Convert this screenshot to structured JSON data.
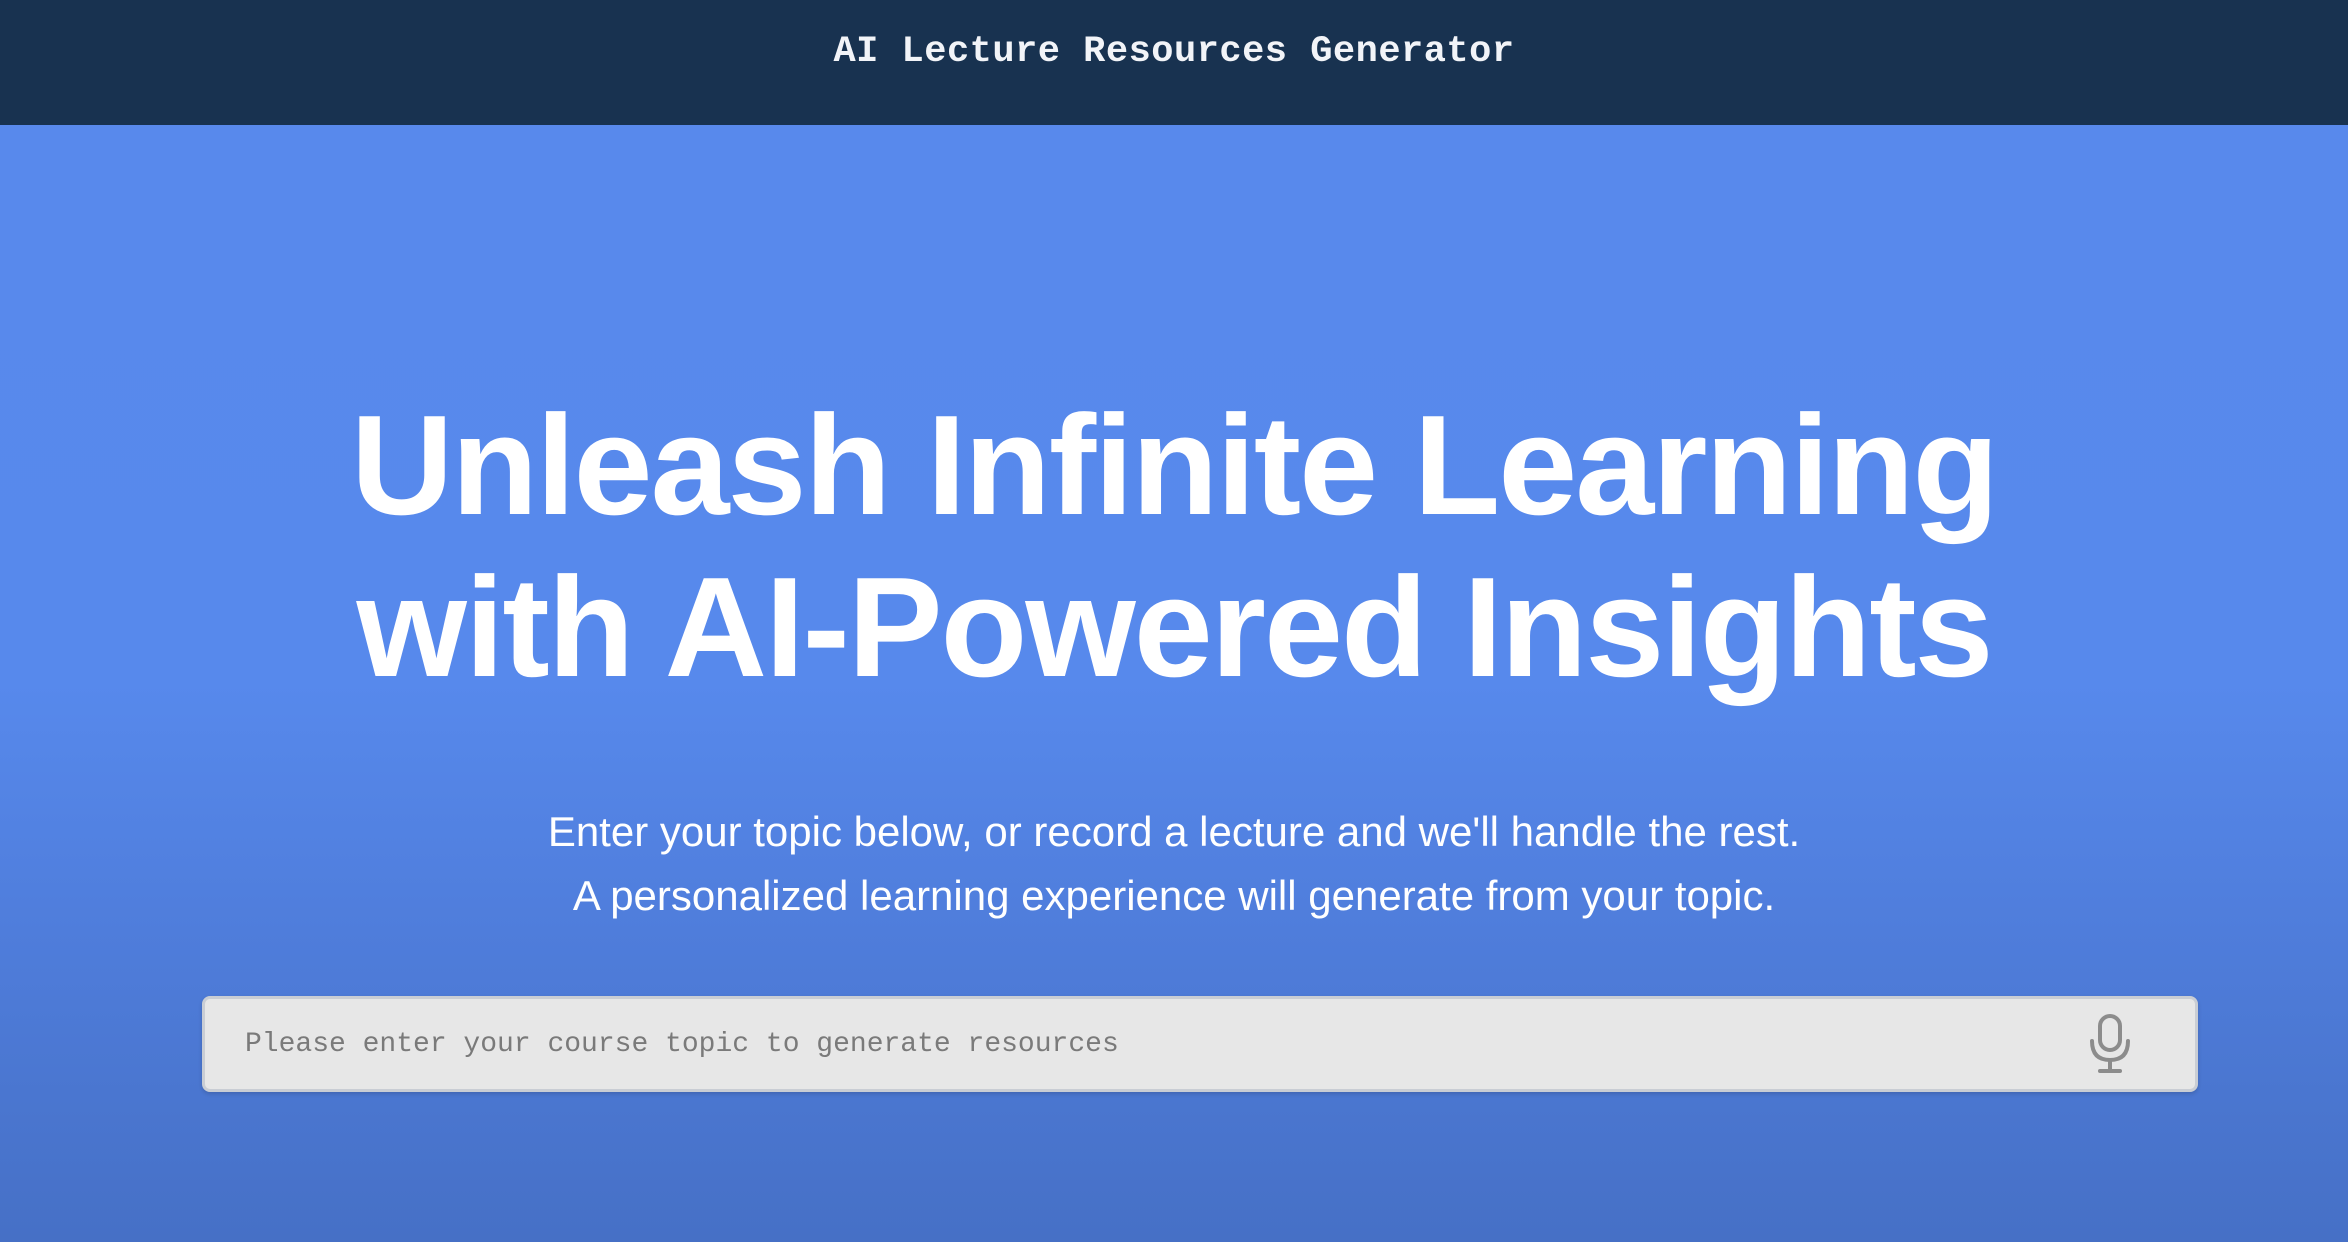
{
  "header": {
    "title": "AI Lecture Resources Generator"
  },
  "hero": {
    "heading_line1": "Unleash Infinite Learning",
    "heading_line2": "with AI-Powered Insights",
    "subtitle_line1": "Enter your topic below, or record a lecture and we'll handle the rest.",
    "subtitle_line2": "A personalized learning experience will generate from your topic."
  },
  "search": {
    "placeholder": "Please enter your course topic to generate resources",
    "value": "",
    "mic_icon": "microphone-icon"
  },
  "colors": {
    "header_bg": "#183250",
    "page_bg": "#5789ec",
    "input_bg": "#e7e7e7",
    "text": "#ffffff"
  }
}
